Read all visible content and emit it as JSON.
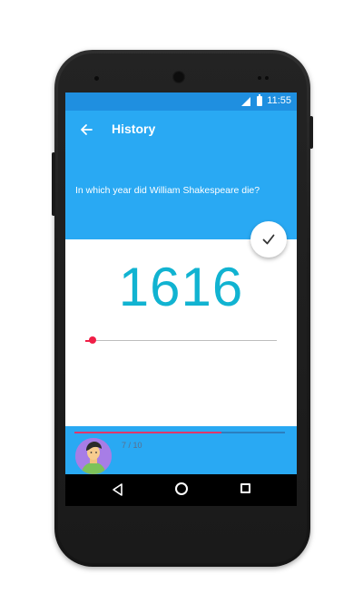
{
  "status_bar": {
    "time": "11:55",
    "signal_icon": "signal-icon",
    "battery_icon": "battery-icon"
  },
  "app_bar": {
    "title": "History",
    "back_icon": "arrow-back-icon"
  },
  "quiz": {
    "question": "In which year did William Shakespeare die?",
    "answer_year": "1616",
    "confirm_icon": "check-icon",
    "slider_value_fraction": 0.04
  },
  "progress": {
    "label": "7 / 10",
    "current": 7,
    "total": 10
  },
  "colors": {
    "primary_blue": "#29a9f3",
    "status_blue": "#1f8fe0",
    "year_cyan": "#11b3d1",
    "slider_red": "#f01f47",
    "progress_pink": "#e2366a",
    "avatar_purple": "#a77de6"
  },
  "nav_bar": {
    "back_icon": "triangle-back-icon",
    "home_icon": "circle-home-icon",
    "recents_icon": "square-recents-icon"
  }
}
